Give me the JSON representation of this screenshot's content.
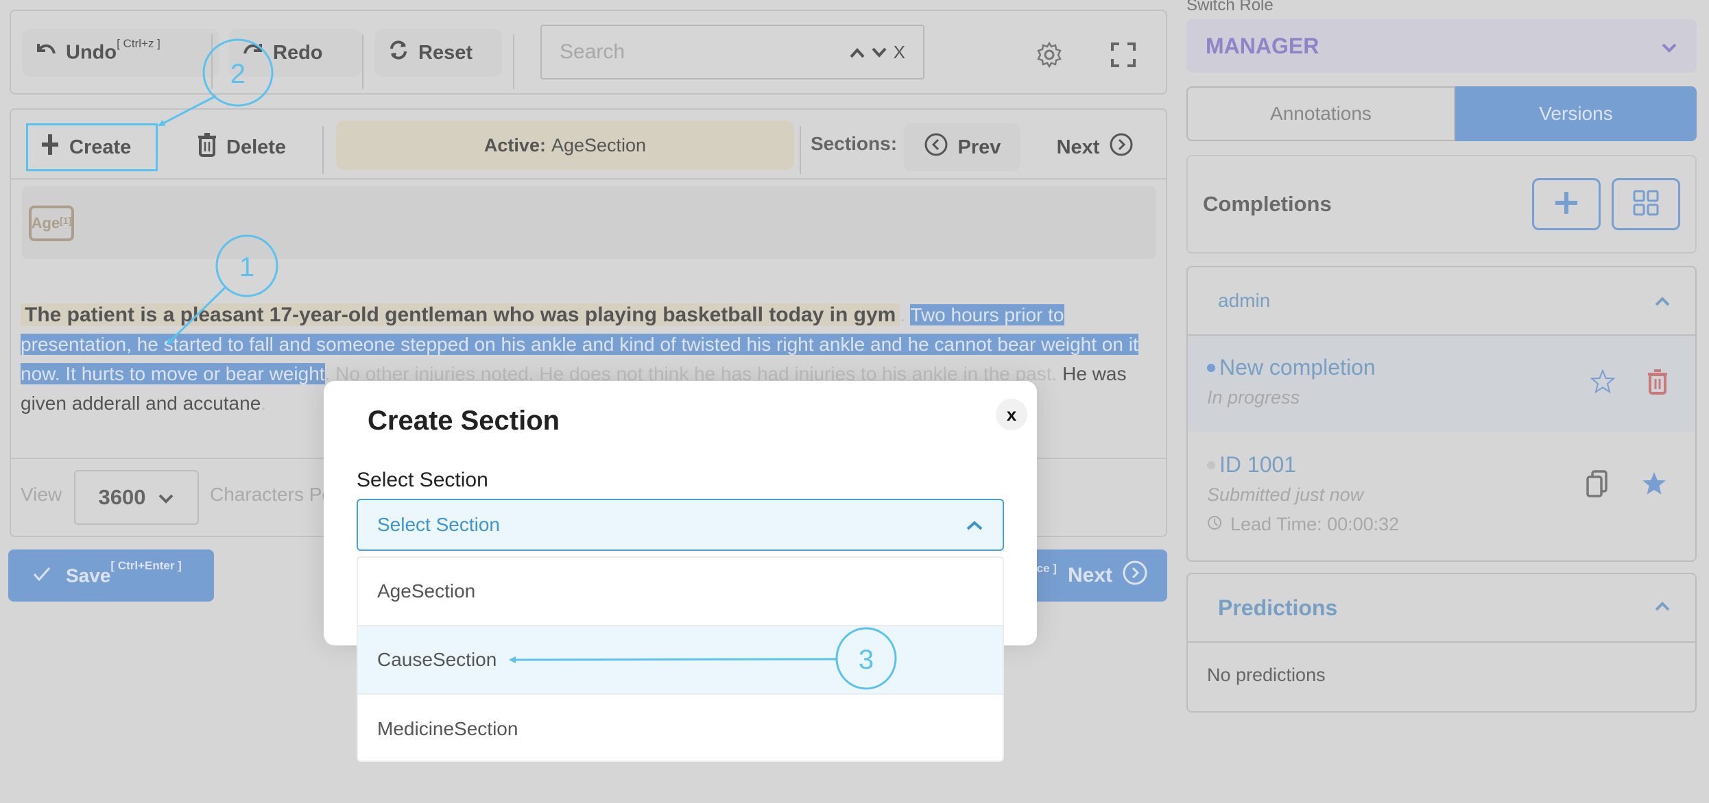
{
  "toolbar": {
    "undo_label": "Undo",
    "undo_shortcut": "[ Ctrl+z ]",
    "redo_label": "Redo",
    "reset_label": "Reset",
    "search_placeholder": "Search",
    "search_prev": "⌃",
    "search_next": "⌄",
    "search_clear": "X"
  },
  "sections_bar": {
    "create_label": "Create",
    "delete_label": "Delete",
    "active_prefix": "Active:",
    "active_value": "AgeSection",
    "sections_label": "Sections:",
    "prev_label": "Prev",
    "next_label": "Next"
  },
  "labels": [
    {
      "text": "Age",
      "index": "[1]"
    }
  ],
  "document": {
    "age_span": "The patient is a pleasant 17-year-old gentleman who was playing basketball today in gym",
    "dot1": ".",
    "selected_span": "Two hours prior to presentation, he started to fall and someone stepped on his ankle and kind of twisted his right ankle and he cannot bear weight on it now. It hurts to move or bear weight",
    "dot2": ".",
    "faded_span": "No other injuries noted. He does not think he has had injuries to his ankle in the past.",
    "plain_span": "He was given adderall and accutane",
    "dot3": "."
  },
  "view": {
    "label": "View",
    "value": "3600",
    "chars_label": "Characters Per Page"
  },
  "actions": {
    "save_label": "Save",
    "save_shortcut": "[ Ctrl+Enter ]",
    "next_shortcut": "[ Space ]",
    "next_label": "Next"
  },
  "sidebar": {
    "switch_role_label": "Switch Role",
    "role_value": "MANAGER",
    "tabs": [
      {
        "label": "Annotations",
        "active": false
      },
      {
        "label": "Versions",
        "active": true
      }
    ],
    "completions_title": "Completions",
    "group_name": "admin",
    "completions": [
      {
        "title": "New completion",
        "status": "In progress",
        "selected": true
      },
      {
        "title": "ID 1001",
        "status": "Submitted just now",
        "lead_time": "Lead Time: 00:00:32",
        "starred": true
      }
    ],
    "predictions_title": "Predictions",
    "predictions_empty": "No predictions"
  },
  "modal": {
    "title": "Create Section",
    "close_label": "x",
    "field_label": "Select Section",
    "select_placeholder": "Select Section",
    "options": [
      "AgeSection",
      "CauseSection",
      "MedicineSection"
    ],
    "hovered_option": "CauseSection"
  },
  "annotations": {
    "step1": "1",
    "step2": "2",
    "step3": "3"
  },
  "colors": {
    "accent_blue": "#789fd2",
    "annotation_cyan": "#5bc2ef",
    "age_highlight": "#d5d0bf",
    "role_purple": "#8f84c7",
    "delete_red": "#c97a7a"
  }
}
